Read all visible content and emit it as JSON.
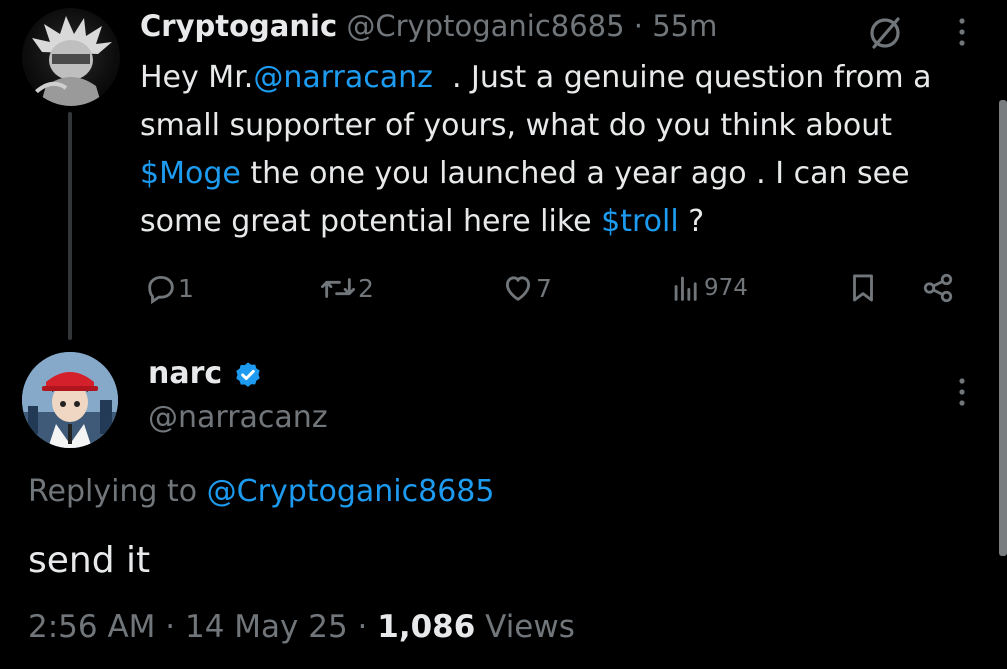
{
  "parent_tweet": {
    "author_name": "Cryptoganic",
    "author_handle": "@Cryptoganic8685",
    "separator": "·",
    "time_ago": "55m",
    "text": {
      "part1": "Hey Mr.",
      "mention": "@narracanz",
      "part2": "  . Just a genuine question from a small supporter of yours, what do you think about ",
      "cashtag1": "$Moge",
      "part3": " the one you launched a year ago . I can see some great potential here like ",
      "cashtag2": "$troll",
      "part4": " ?"
    },
    "actions": {
      "replies": "1",
      "reposts": "2",
      "likes": "7",
      "views": "974"
    }
  },
  "reply_tweet": {
    "author_name": "narc",
    "author_handle": "@narracanz",
    "verified": true,
    "replying_prefix": "Replying to ",
    "replying_to": "@Cryptoganic8685",
    "text": "send it",
    "time": "2:56 AM",
    "sep1": " · ",
    "date": "14 May 25",
    "sep2": " · ",
    "views_count": "1,086",
    "views_label": " Views"
  },
  "colors": {
    "background": "#000000",
    "text_primary": "#e7e9ea",
    "text_secondary": "#71767b",
    "link": "#1d9bf0",
    "verified_badge": "#1d9bf0"
  },
  "icons": [
    "grok-icon",
    "more-icon",
    "reply-icon",
    "repost-icon",
    "like-icon",
    "views-icon",
    "bookmark-icon",
    "share-icon",
    "verified-icon"
  ]
}
